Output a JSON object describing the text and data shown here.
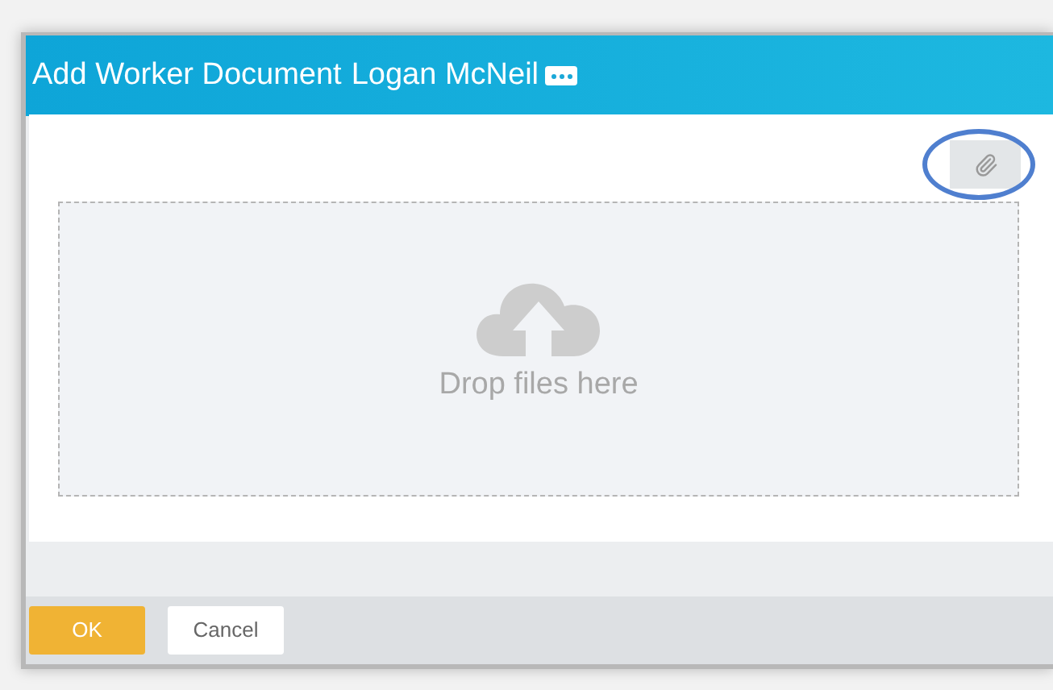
{
  "dialog": {
    "title": "Add Worker Document",
    "subtitle": "Logan McNeil"
  },
  "dropzone": {
    "label": "Drop files here"
  },
  "buttons": [
    {
      "label": "OK",
      "kind": "primary"
    },
    {
      "label": "Cancel",
      "kind": "secondary"
    }
  ]
}
